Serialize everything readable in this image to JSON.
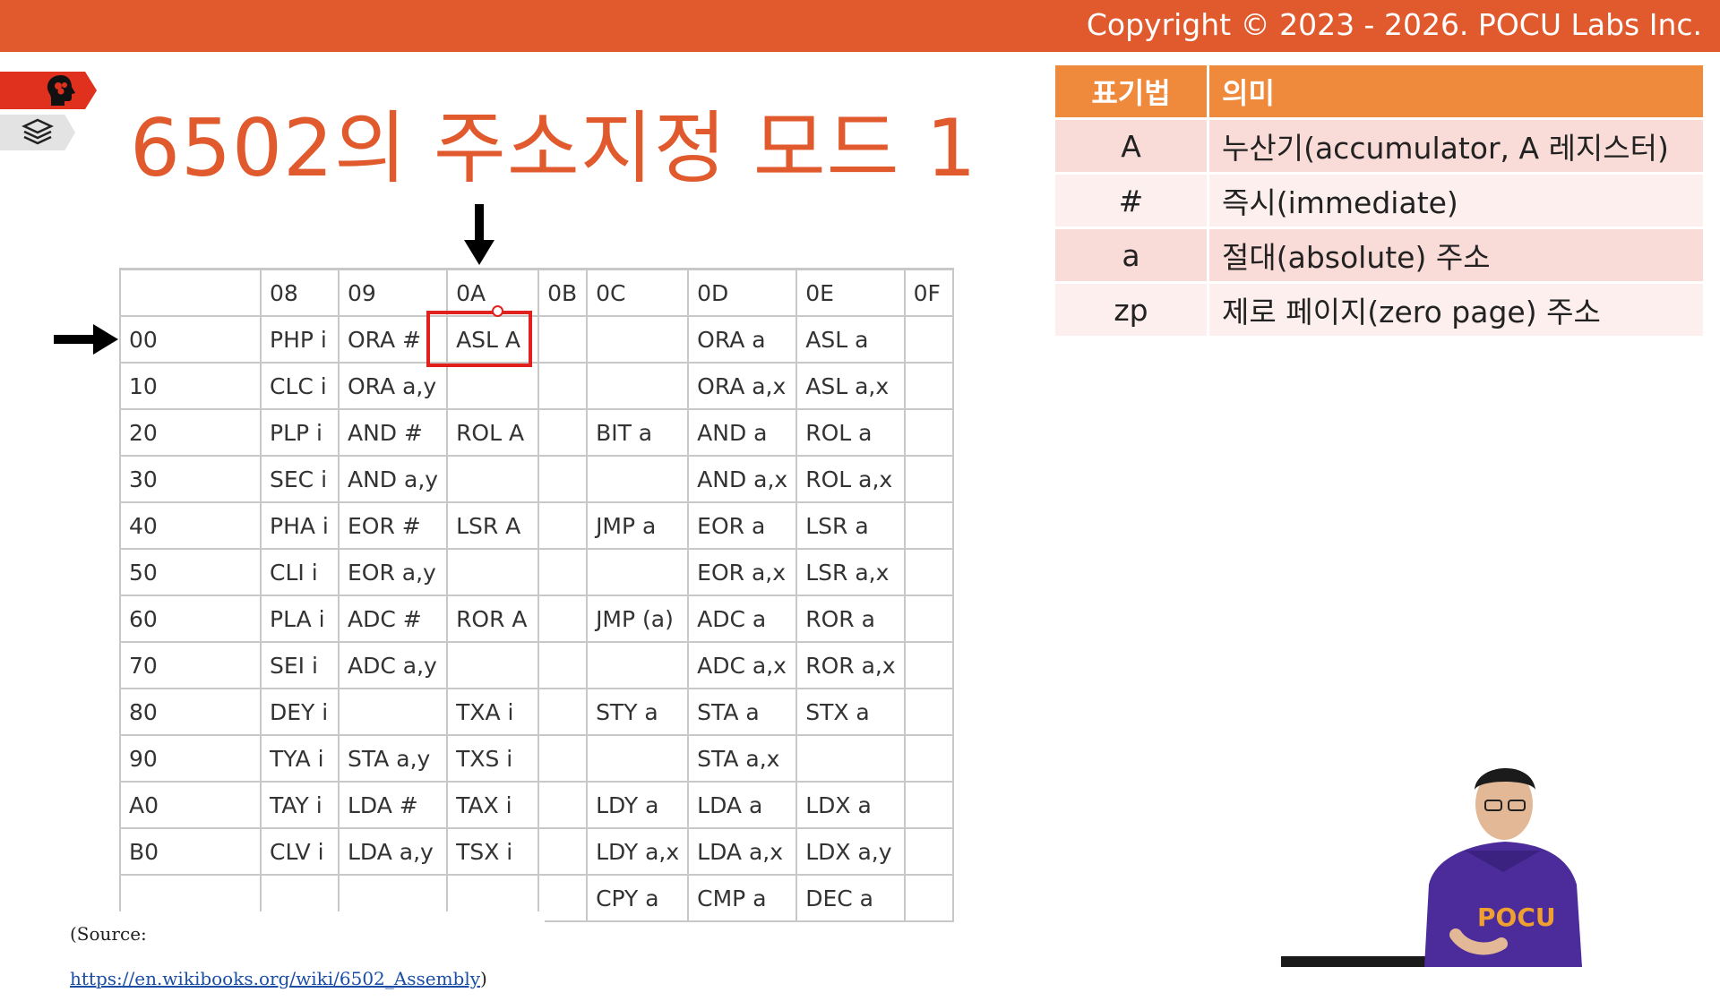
{
  "copyright": "Copyright © 2023 - 2026. POCU Labs Inc.",
  "title": "6502의 주소지정 모드 1",
  "icons": [
    "brain-head-icon",
    "layers-stack-icon",
    "arrow-down-icon",
    "arrow-right-icon"
  ],
  "colors": {
    "brand": "#e05a2e",
    "highlight": "#e0211d",
    "legend_header": "#ef8a3c"
  },
  "opcode_table": {
    "header": [
      "",
      "08",
      "09",
      "0A",
      "0B",
      "0C",
      "0D",
      "0E",
      "0F"
    ],
    "rows": [
      [
        "00",
        "PHP i",
        "ORA #",
        "ASL A",
        "",
        "",
        "ORA a",
        "ASL a",
        ""
      ],
      [
        "10",
        "CLC i",
        "ORA a,y",
        "",
        "",
        "",
        "ORA a,x",
        "ASL a,x",
        ""
      ],
      [
        "20",
        "PLP i",
        "AND #",
        "ROL A",
        "",
        "BIT a",
        "AND a",
        "ROL a",
        ""
      ],
      [
        "30",
        "SEC i",
        "AND a,y",
        "",
        "",
        "",
        "AND a,x",
        "ROL a,x",
        ""
      ],
      [
        "40",
        "PHA i",
        "EOR #",
        "LSR A",
        "",
        "JMP a",
        "EOR a",
        "LSR a",
        ""
      ],
      [
        "50",
        "CLI i",
        "EOR a,y",
        "",
        "",
        "",
        "EOR a,x",
        "LSR a,x",
        ""
      ],
      [
        "60",
        "PLA i",
        "ADC #",
        "ROR A",
        "",
        "JMP (a)",
        "ADC a",
        "ROR a",
        ""
      ],
      [
        "70",
        "SEI i",
        "ADC a,y",
        "",
        "",
        "",
        "ADC a,x",
        "ROR a,x",
        ""
      ],
      [
        "80",
        "DEY i",
        "",
        "TXA i",
        "",
        "STY a",
        "STA a",
        "STX a",
        ""
      ],
      [
        "90",
        "TYA i",
        "STA a,y",
        "TXS i",
        "",
        "",
        "STA a,x",
        "",
        ""
      ],
      [
        "A0",
        "TAY i",
        "LDA #",
        "TAX i",
        "",
        "LDY a",
        "LDA a",
        "LDX a",
        ""
      ],
      [
        "B0",
        "CLV i",
        "LDA a,y",
        "TSX i",
        "",
        "LDY a,x",
        "LDA a,x",
        "LDX a,y",
        ""
      ],
      [
        "",
        "",
        "",
        "",
        "",
        "CPY a",
        "CMP a",
        "DEC a",
        ""
      ]
    ],
    "highlighted_cell": "ASL A"
  },
  "source": {
    "prefix": "(Source: ",
    "link": "https://en.wikibooks.org/wiki/6502_Assembly",
    "suffix": ")"
  },
  "legend": {
    "headers": [
      "표기법",
      "의미"
    ],
    "rows": [
      [
        "A",
        "누산기(accumulator, A 레지스터)"
      ],
      [
        "#",
        "즉시(immediate)"
      ],
      [
        "a",
        "절대(absolute) 주소"
      ],
      [
        "zp",
        "제로 페이지(zero page) 주소"
      ]
    ]
  },
  "presenter_shirt_text": "POCU"
}
